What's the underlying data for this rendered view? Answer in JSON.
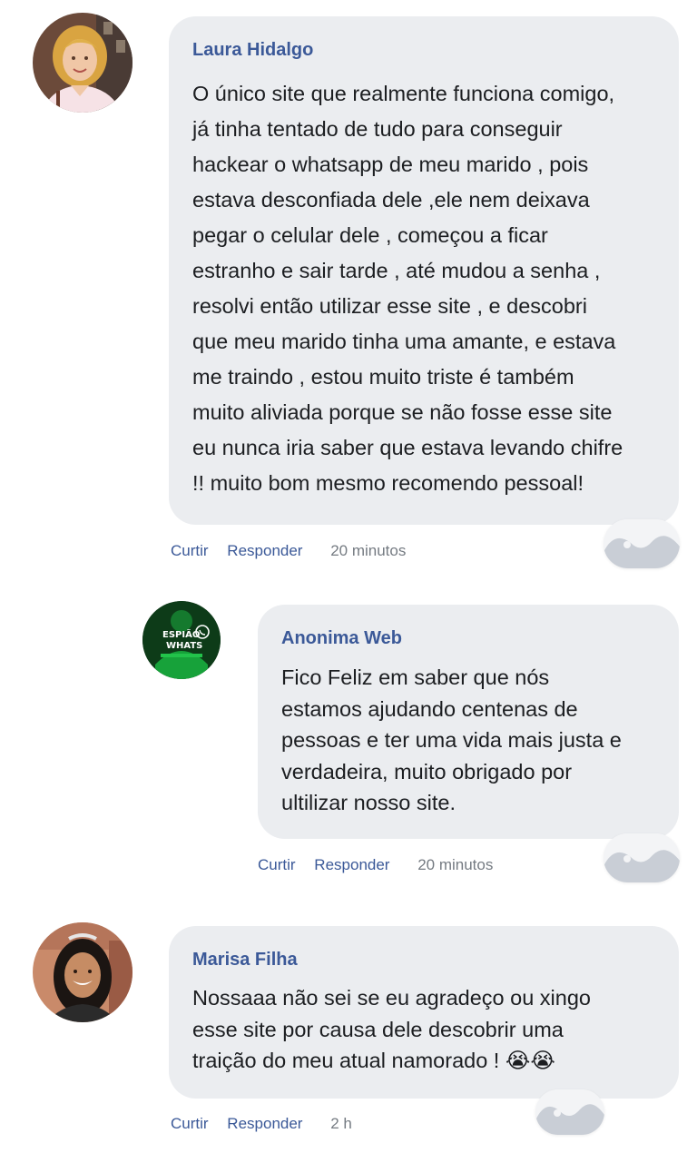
{
  "comments": [
    {
      "author": "Laura Hidalgo",
      "lines": [
        "O único site que realmente funciona comigo,",
        "já tinha tentado de tudo para conseguir",
        "hackear o whatsapp de meu marido , pois",
        "estava desconfiada dele ,ele nem deixava",
        "pegar o celular dele , começou a ficar",
        "estranho e sair tarde , até mudou a senha ,",
        "resolvi então utilizar esse site , e descobri",
        "que meu marido tinha uma amante, e estava",
        "me traindo , estou muito triste é também",
        "muito aliviada porque se não fosse esse site",
        "eu nunca iria saber que estava levando chifre",
        "!! muito bom mesmo recomendo pessoal!"
      ],
      "actions": {
        "like": "Curtir",
        "reply": "Responder"
      },
      "time": "20 minutos"
    },
    {
      "author": "Anonima Web",
      "avatar_text": [
        "ESPIÃO",
        "WHATS"
      ],
      "lines": [
        "Fico Feliz em saber que nós",
        "estamos ajudando centenas de",
        "pessoas e ter uma vida mais justa e",
        "verdadeira, muito obrigado por",
        "ultilizar nosso site."
      ],
      "actions": {
        "like": "Curtir",
        "reply": "Responder"
      },
      "time": "20 minutos"
    },
    {
      "author": "Marisa Filha",
      "lines": [
        "Nossaaa não sei se eu agradeço ou xingo",
        "esse site por causa dele descobrir uma",
        "traição do meu atual namorado ! 😭😭"
      ],
      "actions": {
        "like": "Curtir",
        "reply": "Responder"
      },
      "time": "2 h"
    }
  ],
  "colors": {
    "bubble": "#ebedf0",
    "author": "#3b5998",
    "text": "#1c1e21",
    "meta_time": "#757b82"
  }
}
